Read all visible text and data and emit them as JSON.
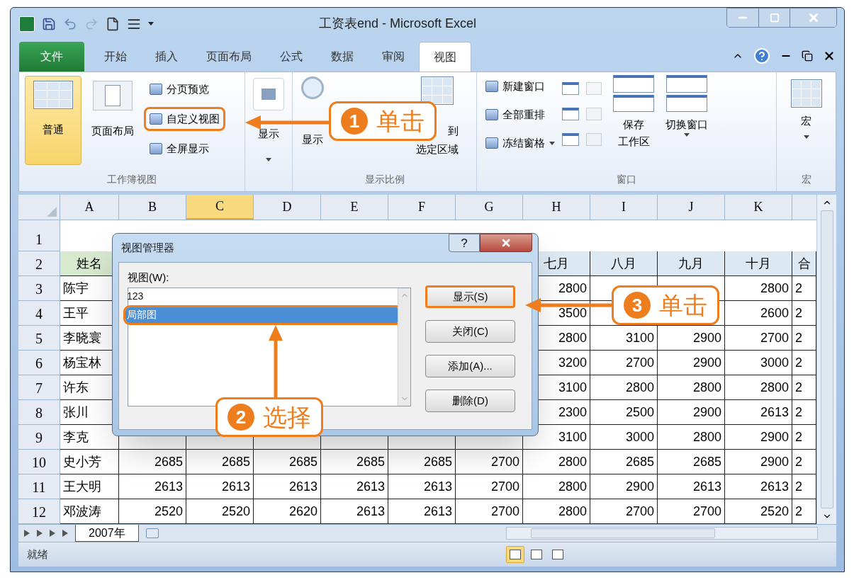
{
  "window": {
    "title": "工资表end - Microsoft Excel"
  },
  "ribbon_tabs": [
    {
      "label": "文件",
      "kind": "file",
      "selected": false
    },
    {
      "label": "开始",
      "kind": "tab",
      "selected": false
    },
    {
      "label": "插入",
      "kind": "tab",
      "selected": false
    },
    {
      "label": "页面布局",
      "kind": "tab",
      "selected": false
    },
    {
      "label": "公式",
      "kind": "tab",
      "selected": false
    },
    {
      "label": "数据",
      "kind": "tab",
      "selected": false
    },
    {
      "label": "审阅",
      "kind": "tab",
      "selected": false
    },
    {
      "label": "视图",
      "kind": "tab",
      "selected": true
    }
  ],
  "ribbon": {
    "workbook_views": {
      "label": "工作簿视图",
      "large": [
        {
          "label": "普通",
          "selected": true
        },
        {
          "label": "页面布局",
          "selected": false
        }
      ],
      "small": [
        {
          "label": "分页预览",
          "highlighted": false
        },
        {
          "label": "自定义视图",
          "highlighted": true
        },
        {
          "label": "全屏显示",
          "highlighted": false
        }
      ]
    },
    "show": {
      "label": "显示"
    },
    "zoom": {
      "label": "显示比例",
      "buttons": [
        {
          "lines": [
            "显示"
          ]
        },
        {
          "lines": [
            "到",
            "选定区域"
          ]
        }
      ]
    },
    "window_group": {
      "label": "窗口",
      "small": [
        {
          "label": "新建窗口",
          "dropdown": false
        },
        {
          "label": "全部重排",
          "dropdown": false
        },
        {
          "label": "冻结窗格",
          "dropdown": true
        }
      ],
      "large": [
        {
          "lines": [
            "保存",
            "工作区"
          ],
          "dropdown": false
        },
        {
          "lines": [
            "切换窗口"
          ],
          "dropdown": true
        }
      ]
    },
    "macros": {
      "label": "宏",
      "button": "宏"
    }
  },
  "sheet": {
    "columns": [
      {
        "label": "A",
        "selected": false
      },
      {
        "label": "B",
        "selected": false
      },
      {
        "label": "C",
        "selected": true
      },
      {
        "label": "D",
        "selected": false
      },
      {
        "label": "E",
        "selected": false
      },
      {
        "label": "F",
        "selected": false
      },
      {
        "label": "G",
        "selected": false
      },
      {
        "label": "H",
        "selected": false
      },
      {
        "label": "I",
        "selected": false
      },
      {
        "label": "J",
        "selected": false
      },
      {
        "label": "K",
        "selected": false
      }
    ],
    "rows": [
      {
        "header": "1",
        "kind": "title"
      },
      {
        "header": "2",
        "kind": "heading",
        "cells": [
          "姓名",
          null,
          null,
          null,
          null,
          null,
          null,
          "七月",
          "八月",
          "九月",
          "十月",
          "合"
        ]
      },
      {
        "header": "3",
        "kind": "data",
        "cells": [
          "陈宇",
          null,
          null,
          null,
          null,
          null,
          null,
          "2800",
          null,
          null,
          "2800",
          "2"
        ]
      },
      {
        "header": "4",
        "kind": "data",
        "cells": [
          "王平",
          null,
          null,
          null,
          null,
          null,
          null,
          "3500",
          null,
          null,
          "2600",
          "2"
        ]
      },
      {
        "header": "5",
        "kind": "data",
        "cells": [
          "李晓寰",
          null,
          null,
          null,
          null,
          null,
          null,
          "2800",
          "3100",
          "2900",
          "2700",
          "2"
        ]
      },
      {
        "header": "6",
        "kind": "data",
        "cells": [
          "杨宝林",
          null,
          null,
          null,
          null,
          null,
          null,
          "3200",
          "2700",
          "2900",
          "3000",
          "2"
        ]
      },
      {
        "header": "7",
        "kind": "data",
        "cells": [
          "许东",
          null,
          null,
          null,
          null,
          null,
          null,
          "3100",
          "2800",
          "2800",
          "2800",
          "2"
        ]
      },
      {
        "header": "8",
        "kind": "data",
        "cells": [
          "张川",
          null,
          null,
          null,
          null,
          null,
          null,
          "2300",
          "2500",
          "2900",
          "2613",
          "2"
        ]
      },
      {
        "header": "9",
        "kind": "data",
        "cells": [
          "李克",
          null,
          null,
          null,
          null,
          null,
          null,
          "3100",
          "3000",
          "2800",
          "2900",
          "2"
        ]
      },
      {
        "header": "10",
        "kind": "data",
        "cells": [
          "史小芳",
          "2685",
          "2685",
          "2685",
          "2685",
          "2685",
          "2700",
          "2800",
          "2685",
          "2685",
          "2900",
          "2"
        ]
      },
      {
        "header": "11",
        "kind": "data",
        "cells": [
          "王大明",
          "2613",
          "2613",
          "2613",
          "2613",
          "2613",
          "2700",
          "2800",
          "2900",
          "2613",
          "2613",
          "2"
        ]
      },
      {
        "header": "12",
        "kind": "data",
        "cells": [
          "邓波涛",
          "2520",
          "2520",
          "2620",
          "2613",
          "2613",
          "2700",
          "2800",
          "2700",
          "2700",
          "2520",
          "2"
        ]
      }
    ]
  },
  "dialog": {
    "title": "视图管理器",
    "help": "?",
    "list_label": "视图(W):",
    "items": [
      {
        "label": "123",
        "selected": false,
        "highlighted": false
      },
      {
        "label": "局部图",
        "selected": true,
        "highlighted": true
      }
    ],
    "buttons": [
      {
        "label": "显示(S)",
        "highlighted": true
      },
      {
        "label": "关闭(C)",
        "highlighted": false
      },
      {
        "label": "添加(A)...",
        "highlighted": false
      },
      {
        "label": "删除(D)",
        "highlighted": false
      }
    ]
  },
  "callouts": [
    {
      "number": "1",
      "text": "单击"
    },
    {
      "number": "2",
      "text": "选择"
    },
    {
      "number": "3",
      "text": "单击"
    }
  ],
  "sheet_tabs": [
    {
      "label": "2007年",
      "selected": true
    }
  ],
  "status_bar": {
    "text": "就绪",
    "views": [
      {
        "selected": true
      },
      {
        "selected": false
      },
      {
        "selected": false
      }
    ]
  }
}
